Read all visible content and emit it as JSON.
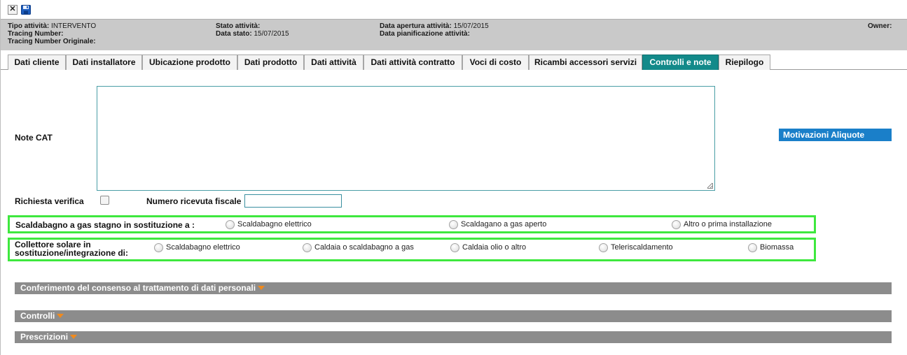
{
  "toolbar": {
    "close_icon": "close-icon",
    "save_icon": "save-icon"
  },
  "header": {
    "tipo_attivita_label": "Tipo attività:",
    "tipo_attivita_value": "INTERVENTO",
    "tracing_number_label": "Tracing Number:",
    "tracing_number_value": "",
    "tracing_number_orig_label": "Tracing Number Originale:",
    "tracing_number_orig_value": "",
    "stato_attivita_label": "Stato attività:",
    "stato_attivita_value": "",
    "data_stato_label": "Data stato:",
    "data_stato_value": "15/07/2015",
    "data_apertura_label": "Data apertura attività:",
    "data_apertura_value": "15/07/2015",
    "data_pianificazione_label": "Data pianificazione attività:",
    "data_pianificazione_value": "",
    "owner_label": "Owner:",
    "owner_value": ""
  },
  "tabs": [
    {
      "label": "Dati cliente"
    },
    {
      "label": "Dati installatore"
    },
    {
      "label": "Ubicazione prodotto"
    },
    {
      "label": "Dati prodotto"
    },
    {
      "label": "Dati attività"
    },
    {
      "label": "Dati attività contratto"
    },
    {
      "label": "Voci di costo"
    },
    {
      "label": "Ricambi accessori servizi"
    },
    {
      "label": "Controlli e note",
      "active": true
    },
    {
      "label": "Riepilogo"
    }
  ],
  "form": {
    "note_cat_label": "Note CAT",
    "note_cat_value": "",
    "motivazioni_button": "Motivazioni Aliquote",
    "richiesta_verifica_label": "Richiesta verifica",
    "richiesta_verifica_checked": false,
    "numero_ricevuta_label": "Numero ricevuta fiscale",
    "numero_ricevuta_value": ""
  },
  "scaldabagno": {
    "label": "Scaldabagno a gas stagno in sostituzione a :",
    "options": [
      "Scaldabagno elettrico",
      "Scaldagano a gas aperto",
      "Altro o prima installazione"
    ]
  },
  "collettore": {
    "label_line1": "Collettore solare in",
    "label_line2": "sostituzione/integrazione di:",
    "options": [
      "Scaldabagno elettrico",
      "Caldaia o scaldabagno a gas",
      "Caldaia olio o altro",
      "Teleriscaldamento",
      "Biomassa"
    ]
  },
  "sections": [
    {
      "label": "Conferimento del consenso al trattamento di dati personali"
    },
    {
      "label": "Controlli"
    },
    {
      "label": "Prescrizioni"
    }
  ],
  "colors": {
    "accent_tab": "#138a8a",
    "button_blue": "#1a7fc9",
    "highlight_green": "#3ee83e",
    "caret_orange": "#f08a1e"
  }
}
